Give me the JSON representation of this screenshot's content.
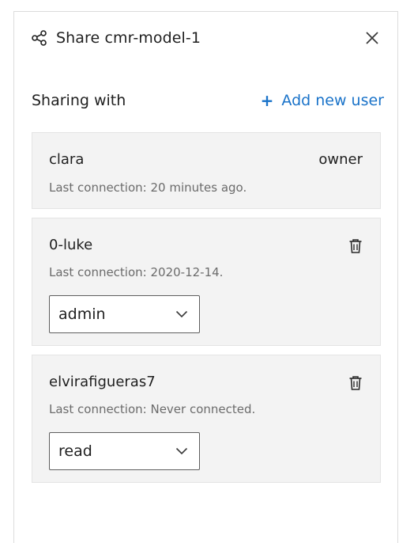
{
  "dialog": {
    "title": "Share cmr-model-1",
    "share_icon": "share-icon",
    "close_icon": "close-icon"
  },
  "sharing": {
    "label": "Sharing with",
    "add_user_plus": "+",
    "add_user_label": "Add new user",
    "accent_color": "#1a73c9"
  },
  "users": [
    {
      "name": "clara",
      "last_connection": "Last connection: 20 minutes ago.",
      "role": "owner"
    },
    {
      "name": "0-luke",
      "last_connection": "Last connection: 2020-12-14.",
      "role_select": "admin",
      "delete_icon": "trash-icon"
    },
    {
      "name": "elvirafigueras7",
      "last_connection": "Last connection: Never connected.",
      "role_select": "read",
      "delete_icon": "trash-icon"
    }
  ]
}
